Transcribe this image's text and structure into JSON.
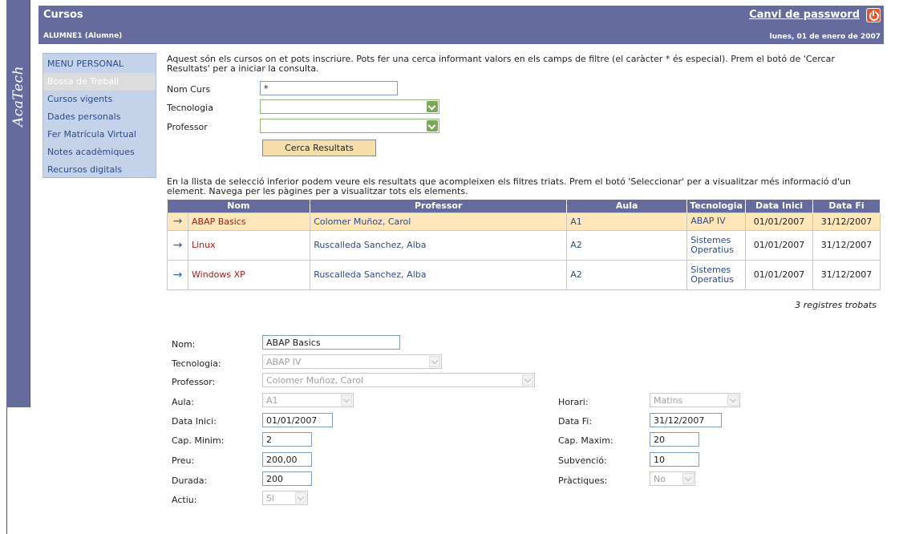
{
  "brand": {
    "name": "AcaTech"
  },
  "header": {
    "title": "Cursos",
    "user": "ALUMNE1 (Alumne)",
    "change_password": "Canvi de password",
    "date": "lunes, 01 de enero de 2007",
    "logout_icon": "power-icon"
  },
  "menu": {
    "heading": "MENU PERSONAL",
    "items": [
      {
        "label": "Bossa de Treball",
        "selected": true
      },
      {
        "label": "Cursos vigents"
      },
      {
        "label": "Dades personals"
      },
      {
        "label": "Fer Matrícula Virtual"
      },
      {
        "label": "Notes acadèmiques"
      },
      {
        "label": "Recursos digitals"
      }
    ]
  },
  "search": {
    "intro": "Aquest són els cursos on et pots inscriure. Pots fer una cerca informant valors en els camps de filtre (el caràcter * és especial). Prem el botó de 'Cercar Resultats' per a iniciar la consulta.",
    "nom_curs_label": "Nom Curs",
    "nom_curs_value": "*",
    "tecnologia_label": "Tecnologia",
    "tecnologia_value": "",
    "professor_label": "Professor",
    "professor_value": "",
    "button": "Cerca Resultats"
  },
  "results": {
    "intro": "En la llista de selecció inferior podem veure els resultats que acompleixen els filtres triats. Prem el botó 'Seleccionar' per a visualitzar més informació d'un element. Navega per les pàgines per a visualitzar tots els elements.",
    "columns": [
      "Nom",
      "Professor",
      "Aula",
      "Tecnologia",
      "Data Inici",
      "Data Fi"
    ],
    "rows": [
      {
        "arrow": "→",
        "nom": "ABAP Basics",
        "professor": "Colomer Muñoz, Carol",
        "aula": "A1",
        "tecnologia": "ABAP IV",
        "inici": "01/01/2007",
        "fi": "31/12/2007"
      },
      {
        "arrow": "→",
        "nom": "Linux",
        "professor": "Ruscalleda Sanchez, Alba",
        "aula": "A2",
        "tecnologia": "Sistemes Operatius",
        "inici": "01/01/2007",
        "fi": "31/12/2007"
      },
      {
        "arrow": "→",
        "nom": "Windows XP",
        "professor": "Ruscalleda Sanchez, Alba",
        "aula": "A2",
        "tecnologia": "Sistemes Operatius",
        "inici": "01/01/2007",
        "fi": "31/12/2007"
      }
    ],
    "count": "3 registres trobats"
  },
  "detail": {
    "nom_label": "Nom:",
    "nom_value": "ABAP Basics",
    "tecnologia_label": "Tecnologia:",
    "tecnologia_value": "ABAP IV",
    "professor_label": "Professor:",
    "professor_value": "Colomer Muñoz, Carol",
    "aula_label": "Aula:",
    "aula_value": "A1",
    "horari_label": "Horari:",
    "horari_value": "Matins",
    "inici_label": "Data Inici:",
    "inici_value": "01/01/2007",
    "fi_label": "Data Fi:",
    "fi_value": "31/12/2007",
    "capmin_label": "Cap. Minim:",
    "capmin_value": "2",
    "capmax_label": "Cap. Maxim:",
    "capmax_value": "20",
    "preu_label": "Preu:",
    "preu_value": "200,00",
    "subvencio_label": "Subvenció:",
    "subvencio_value": "10",
    "durada_label": "Durada:",
    "durada_value": "200",
    "practiques_label": "Pràctiques:",
    "practiques_value": "No",
    "actiu_label": "Actiu:",
    "actiu_value": "Si"
  }
}
